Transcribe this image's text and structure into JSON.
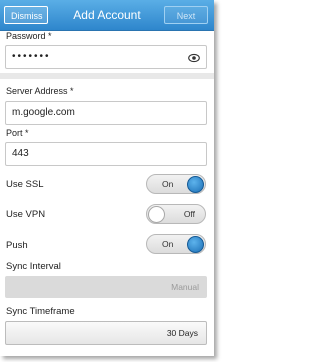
{
  "header": {
    "dismiss_label": "Dismiss",
    "title": "Add Account",
    "next_label": "Next"
  },
  "password": {
    "label": "Password *",
    "value": "•••••••",
    "show_icon": "eye-icon"
  },
  "server": {
    "label": "Server Address *",
    "value": "m.google.com"
  },
  "port": {
    "label": "Port *",
    "value": "443"
  },
  "toggles": [
    {
      "label": "Use SSL",
      "state": "On"
    },
    {
      "label": "Use VPN",
      "state": "Off"
    },
    {
      "label": "Push",
      "state": "On"
    }
  ],
  "sync_interval": {
    "label": "Sync Interval",
    "value": "Manual"
  },
  "sync_timeframe": {
    "label": "Sync Timeframe",
    "value": "30 Days"
  },
  "colors": {
    "accent": "#2e86cc",
    "toggle_on": "#1c6fb6"
  }
}
